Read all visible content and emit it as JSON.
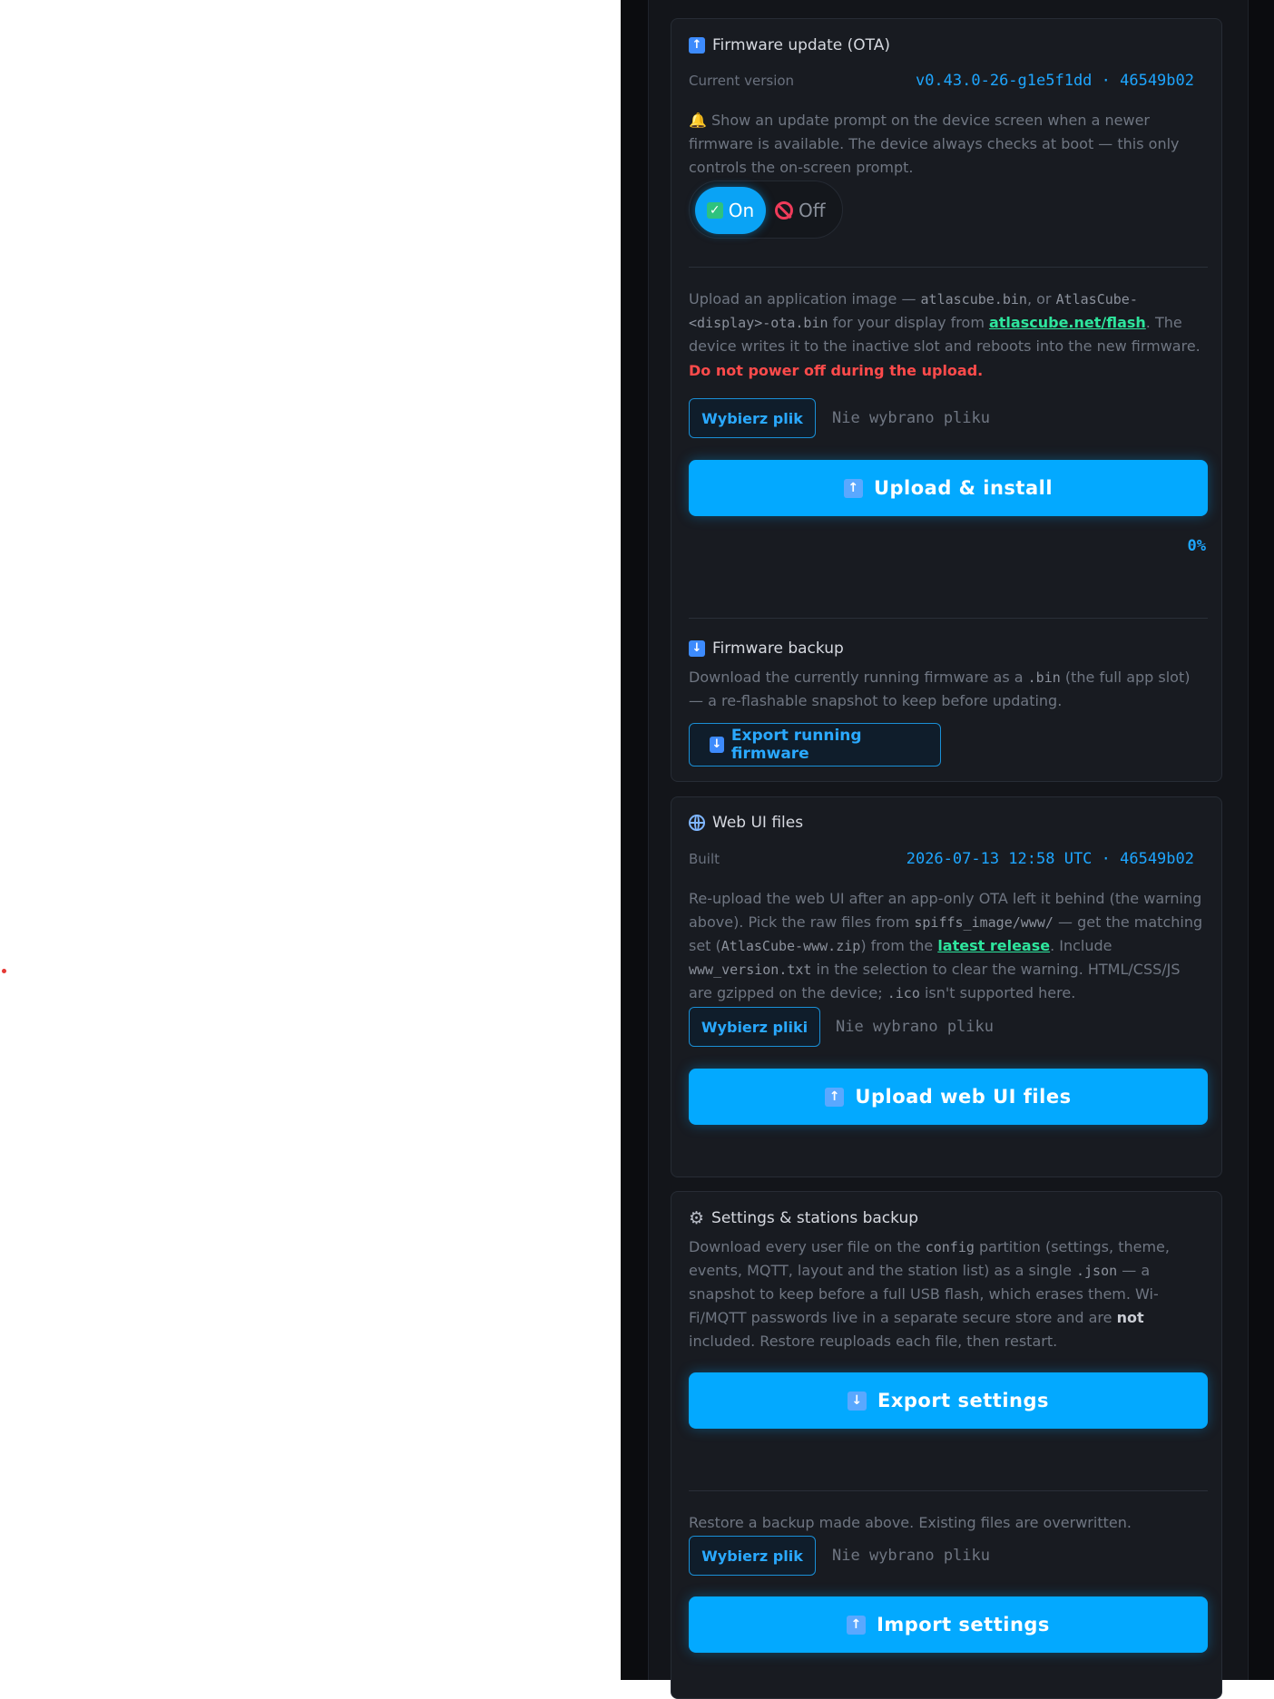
{
  "firmware": {
    "title": "Firmware update (OTA)",
    "current_version_label": "Current version",
    "current_version_value": "v0.43.0-26-g1e5f1dd · 46549b02",
    "prompt_text": "Show an update prompt on the device screen when a newer firmware is available. The device always checks at boot — this only controls the on-screen prompt.",
    "toggle_on": "On",
    "toggle_off": "Off",
    "upload_text_1": "Upload an application image — ",
    "upload_code_1": "atlascube.bin",
    "upload_text_2": ", or ",
    "upload_code_2": "AtlasCube-<display>-ota.bin",
    "upload_text_3": " for your display from ",
    "upload_link": "atlascube.net/flash",
    "upload_text_4": ". The device writes it to the inactive slot and reboots into the new firmware.",
    "upload_warning": "Do not power off during the upload.",
    "choose_file": "Wybierz plik",
    "no_file": "Nie wybrano pliku",
    "upload_button": "Upload & install",
    "progress": "0%",
    "progress_value": 0
  },
  "backup": {
    "title": "Firmware backup",
    "text_1": "Download the currently running firmware as a ",
    "code": ".bin",
    "text_2": " (the full app slot) — a re-flashable snapshot to keep before updating.",
    "export_button": "Export running firmware"
  },
  "webui": {
    "title": "Web UI files",
    "built_label": "Built",
    "built_value": "2026-07-13 12:58 UTC · 46549b02",
    "text_1": "Re-upload the web UI after an app-only OTA left it behind (the warning above). Pick the raw files from ",
    "code_1": "spiffs_image/www/",
    "text_2": " — get the matching set (",
    "code_2": "AtlasCube-www.zip",
    "text_3": ") from the ",
    "link": "latest release",
    "text_4": ". Include ",
    "code_3": "www_version.txt",
    "text_5": " in the selection to clear the warning. HTML/CSS/JS are gzipped on the device; ",
    "code_4": ".ico",
    "text_6": " isn't supported here.",
    "choose_files": "Wybierz pliki",
    "no_file": "Nie wybrano pliku",
    "upload_button": "Upload web UI files"
  },
  "settings": {
    "title": "Settings & stations backup",
    "text_1": "Download every user file on the ",
    "code_1": "config",
    "text_2": " partition (settings, theme, events, MQTT, layout and the station list) as a single ",
    "code_2": ".json",
    "text_3": " — a snapshot to keep before a full USB flash, which erases them. Wi-Fi/MQTT passwords live in a separate secure store and are ",
    "bold": "not",
    "text_4": " included. Restore reuploads each file, then restart.",
    "export_button": "Export settings",
    "restore_text": "Restore a backup made above. Existing files are overwritten.",
    "choose_file": "Wybierz plik",
    "no_file": "Nie wybrano pliku",
    "import_button": "Import settings"
  }
}
